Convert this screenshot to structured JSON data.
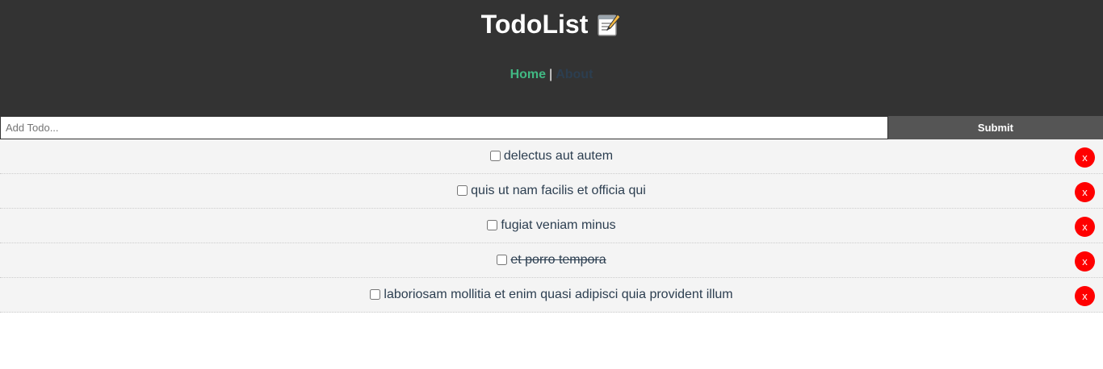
{
  "header": {
    "title": "TodoList",
    "title_icon": "memo-icon",
    "nav": {
      "home_label": "Home",
      "separator": "|",
      "about_label": "About"
    },
    "colors": {
      "background": "#333333",
      "home_link": "#41b883",
      "about_link": "#2c3e50"
    }
  },
  "add_form": {
    "placeholder": "Add Todo...",
    "value": "",
    "submit_label": "Submit"
  },
  "todos": [
    {
      "title": "delectus aut autem",
      "completed": false,
      "delete_label": "x"
    },
    {
      "title": "quis ut nam facilis et officia qui",
      "completed": false,
      "delete_label": "x"
    },
    {
      "title": "fugiat veniam minus",
      "completed": false,
      "delete_label": "x"
    },
    {
      "title": "et porro tempora",
      "completed": true,
      "delete_label": "x"
    },
    {
      "title": "laboriosam mollitia et enim quasi adipisci quia provident illum",
      "completed": false,
      "delete_label": "x"
    }
  ]
}
